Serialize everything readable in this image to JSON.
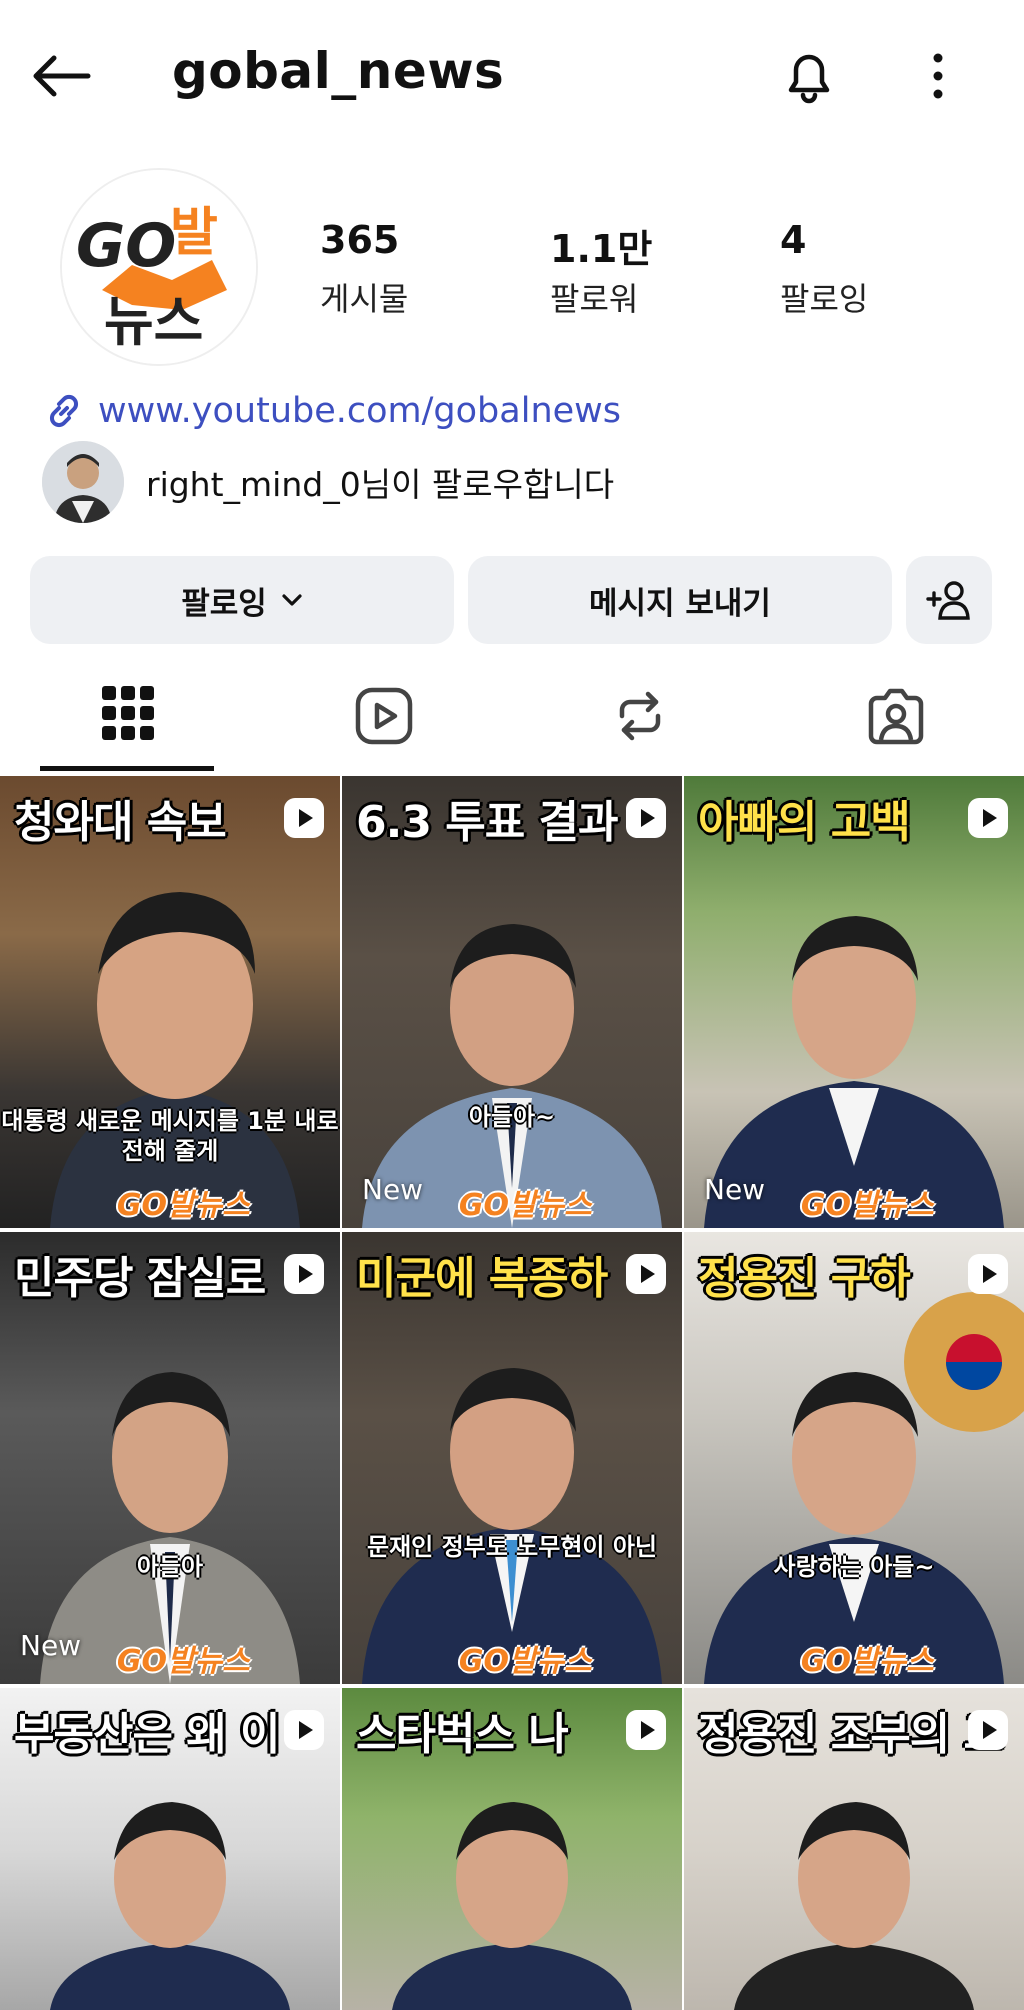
{
  "header": {
    "title": "gobal_news",
    "back_icon": "arrow-left-icon",
    "bell_icon": "bell-icon",
    "more_icon": "more-vertical-icon"
  },
  "profile": {
    "avatar_logo": {
      "go": "GO",
      "bal": "발",
      "news": "뉴스"
    },
    "stats": [
      {
        "value": "365",
        "label": "게시물"
      },
      {
        "value": "1.1만",
        "label": "팔로워"
      },
      {
        "value": "4",
        "label": "팔로잉"
      }
    ],
    "link": "www.youtube.com/gobalnews",
    "followed_by": "right_mind_0님이 팔로우합니다"
  },
  "actions": {
    "follow_label": "팔로잉",
    "message_label": "메시지 보내기",
    "add_user_icon": "add-user-icon"
  },
  "tabs": [
    "grid-icon",
    "reels-icon",
    "reposts-icon",
    "tagged-icon"
  ],
  "colors": {
    "accent_orange": "#f58220",
    "link_blue": "#3d4fc0",
    "button_bg": "#eef0f3",
    "caption_yellow": "#ffe14a"
  },
  "posts": [
    {
      "caption": "청와대 속보",
      "caption_color": "white",
      "subtitle": "대통령 새로운 메시지를 1분 내로 전해 줄게",
      "new": "",
      "watermark": "GO발뉴스"
    },
    {
      "caption": "6.3 투표 결과",
      "caption_color": "white",
      "subtitle": "아들아~",
      "new": "New",
      "watermark": "GO발뉴스"
    },
    {
      "caption": "아빠의 고백",
      "caption_color": "yellow",
      "subtitle": "",
      "new": "New",
      "watermark": "GO발뉴스"
    },
    {
      "caption": "민주당 잠실로",
      "caption_color": "white",
      "subtitle": "아들아",
      "new": "New",
      "watermark": "GO발뉴스"
    },
    {
      "caption": "미군에 복종하",
      "caption_color": "yellow",
      "subtitle": "문재인 정부도 노무현이 아닌",
      "new": "",
      "watermark": "GO발뉴스"
    },
    {
      "caption": "정용진 구하",
      "caption_color": "yellow",
      "subtitle": "사랑하는 아들~",
      "new": "",
      "watermark": "GO발뉴스"
    },
    {
      "caption": "부동산은 왜 이",
      "caption_color": "white",
      "subtitle": "",
      "new": "",
      "watermark": ""
    },
    {
      "caption": "스타벅스 나",
      "caption_color": "white",
      "subtitle": "",
      "new": "",
      "watermark": ""
    },
    {
      "caption": "정용진 조부의 고",
      "caption_color": "white",
      "subtitle": "",
      "new": "",
      "watermark": ""
    }
  ]
}
